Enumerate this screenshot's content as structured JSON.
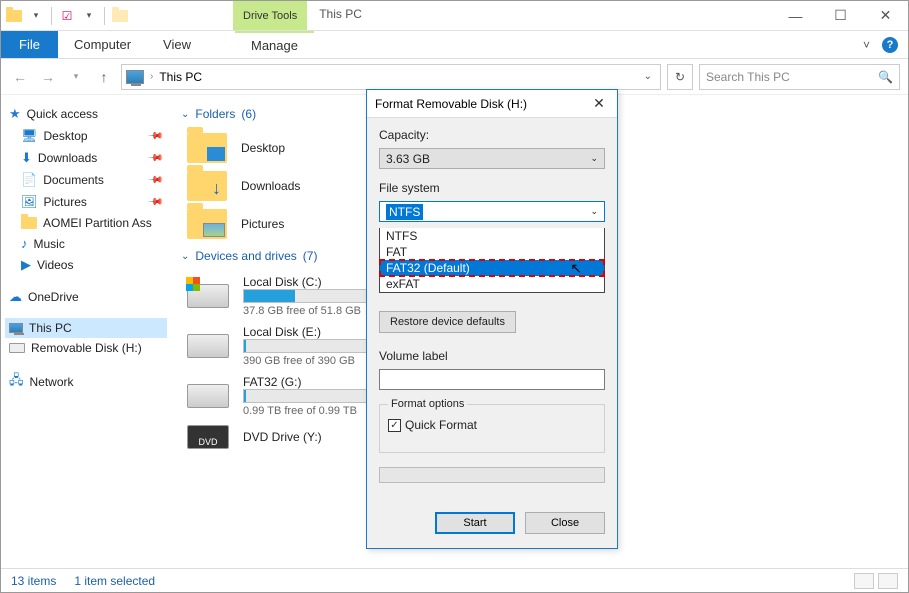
{
  "titlebar": {
    "title": "This PC",
    "drive_tools": "Drive Tools"
  },
  "ribbon": {
    "file": "File",
    "computer": "Computer",
    "view": "View",
    "manage": "Manage"
  },
  "address": {
    "path": "This PC",
    "search_placeholder": "Search This PC"
  },
  "sidebar": {
    "quick_access": "Quick access",
    "desktop": "Desktop",
    "downloads": "Downloads",
    "documents": "Documents",
    "pictures": "Pictures",
    "aomei": "AOMEI Partition Ass",
    "music": "Music",
    "videos": "Videos",
    "onedrive": "OneDrive",
    "this_pc": "This PC",
    "removable": "Removable Disk (H:)",
    "network": "Network"
  },
  "groups": {
    "folders": {
      "label": "Folders",
      "count": "(6)"
    },
    "devices": {
      "label": "Devices and drives",
      "count": "(7)"
    }
  },
  "folders": {
    "desktop": "Desktop",
    "downloads": "Downloads",
    "pictures": "Pictures"
  },
  "drives": {
    "c": {
      "name": "Local Disk (C:)",
      "free": "37.8 GB free of 51.8 GB",
      "fill_pct": 27
    },
    "e": {
      "name": "Local Disk (E:)",
      "free": "390 GB free of 390 GB",
      "fill_pct": 1
    },
    "g": {
      "name": "FAT32 (G:)",
      "free": "0.99 TB free of 0.99 TB",
      "fill_pct": 1
    },
    "y": {
      "name": "DVD Drive (Y:)"
    }
  },
  "statusbar": {
    "items": "13 items",
    "selected": "1 item selected"
  },
  "dialog": {
    "title": "Format Removable Disk (H:)",
    "capacity_label": "Capacity:",
    "capacity_value": "3.63 GB",
    "fs_label": "File system",
    "fs_value": "NTFS",
    "fs_options": {
      "ntfs": "NTFS",
      "fat": "FAT",
      "fat32": "FAT32 (Default)",
      "exfat": "exFAT"
    },
    "restore": "Restore device defaults",
    "volume_label": "Volume label",
    "format_options": "Format options",
    "quick_format": "Quick Format",
    "start": "Start",
    "close": "Close"
  }
}
